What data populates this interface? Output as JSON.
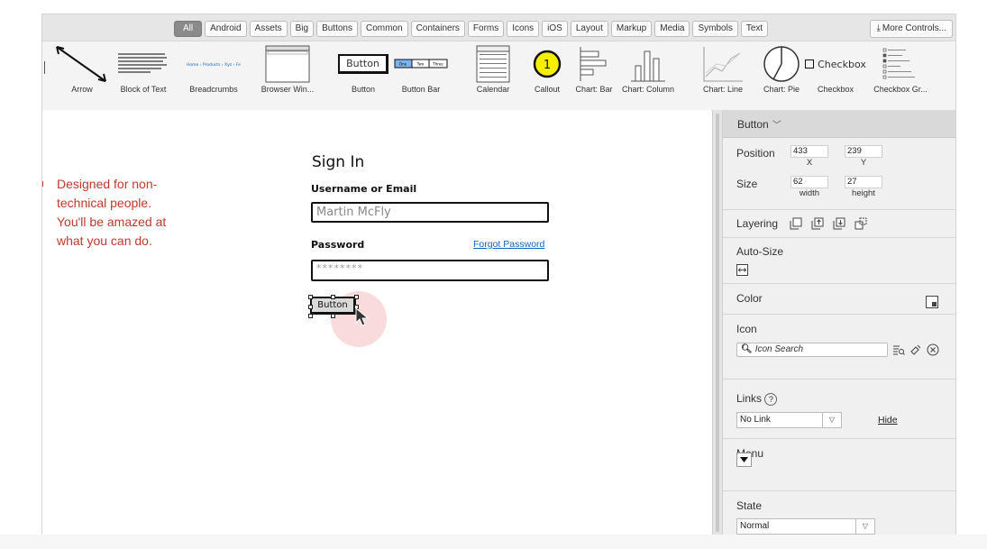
{
  "filters": {
    "chips": [
      "All",
      "Android",
      "Assets",
      "Big",
      "Buttons",
      "Common",
      "Containers",
      "Forms",
      "Icons",
      "iOS",
      "Layout",
      "Markup",
      "Media",
      "Symbols",
      "Text"
    ],
    "active": "All",
    "more_label": "More Controls..."
  },
  "library": {
    "items": [
      {
        "label": "Arrow",
        "thumb": "arrow"
      },
      {
        "label": "Block of Text",
        "thumb": "text-block"
      },
      {
        "label": "Breadcrumbs",
        "thumb": "breadcrumbs"
      },
      {
        "label": "Browser Win...",
        "thumb": "browser"
      },
      {
        "label": "Button",
        "thumb": "button",
        "thumb_text": "Button"
      },
      {
        "label": "Button Bar",
        "thumb": "button-bar",
        "thumb_parts": [
          "One",
          "Two",
          "Three"
        ]
      },
      {
        "label": "Calendar",
        "thumb": "calendar"
      },
      {
        "label": "Callout",
        "thumb": "callout",
        "thumb_text": "1"
      },
      {
        "label": "Chart: Bar",
        "thumb": "chart-bar"
      },
      {
        "label": "Chart: Column",
        "thumb": "chart-column"
      },
      {
        "label": "Chart: Line",
        "thumb": "chart-line"
      },
      {
        "label": "Chart: Pie",
        "thumb": "chart-pie"
      },
      {
        "label": "Checkbox",
        "thumb": "checkbox",
        "thumb_text": "Checkbox"
      },
      {
        "label": "Checkbox Gr...",
        "thumb": "checkbox-group"
      }
    ]
  },
  "canvas": {
    "note": "Designed for non-\ntechnical people.\nYou'll be amazed at\nwhat you can do.",
    "signin_title": "Sign In",
    "username_label": "Username or Email",
    "username_value": "Martin McFly",
    "password_label": "Password",
    "forgot_link": "Forgot Password",
    "password_value": "********",
    "button_label": "Button"
  },
  "inspector": {
    "title": "Button",
    "position_label": "Position",
    "x_value": "433",
    "y_value": "239",
    "x_caption": "X",
    "y_caption": "Y",
    "size_label": "Size",
    "width_value": "62",
    "height_value": "27",
    "width_caption": "width",
    "height_caption": "height",
    "layering_label": "Layering",
    "autosize_label": "Auto-Size",
    "color_label": "Color",
    "icon_label": "Icon",
    "icon_search_placeholder": "Icon Search",
    "links_label": "Links",
    "links_value": "No Link",
    "hide_link": "Hide",
    "menu_label": "Menu",
    "state_label": "State",
    "state_value": "Normal"
  },
  "colors": {
    "note_red": "#c0392b",
    "link_blue": "#1565c0",
    "callout_yellow": "#f6f000"
  }
}
